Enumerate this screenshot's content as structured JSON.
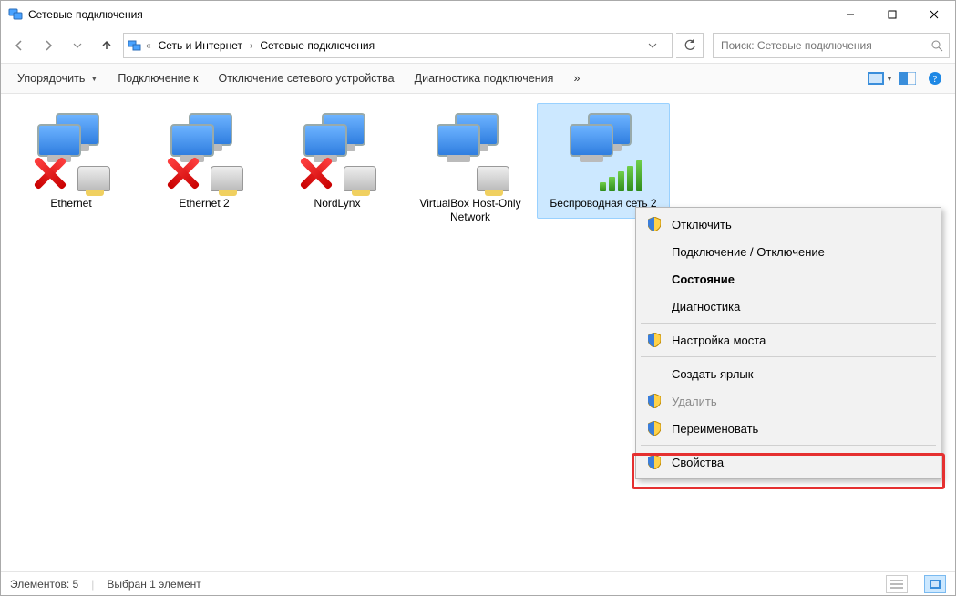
{
  "window": {
    "title": "Сетевые подключения"
  },
  "breadcrumb": {
    "level1": "Сеть и Интернет",
    "level2": "Сетевые подключения"
  },
  "search": {
    "placeholder": "Поиск: Сетевые подключения"
  },
  "toolbar": {
    "organize": "Упорядочить",
    "connect_to": "Подключение к",
    "disable_device": "Отключение сетевого устройства",
    "diagnose": "Диагностика подключения",
    "overflow": "»"
  },
  "items": [
    {
      "label": "Ethernet",
      "status": "disabled"
    },
    {
      "label": "Ethernet 2",
      "status": "disabled"
    },
    {
      "label": "NordLynx",
      "status": "disabled"
    },
    {
      "label": "VirtualBox Host-Only Network",
      "status": "wired"
    },
    {
      "label": "Беспроводная сеть 2",
      "status": "wifi",
      "selected": true
    }
  ],
  "context_menu": {
    "disable": "Отключить",
    "toggle": "Подключение / Отключение",
    "status": "Состояние",
    "diagnose": "Диагностика",
    "bridge": "Настройка моста",
    "shortcut": "Создать ярлык",
    "delete": "Удалить",
    "rename": "Переименовать",
    "properties": "Свойства"
  },
  "statusbar": {
    "count": "Элементов: 5",
    "selection": "Выбран 1 элемент"
  }
}
